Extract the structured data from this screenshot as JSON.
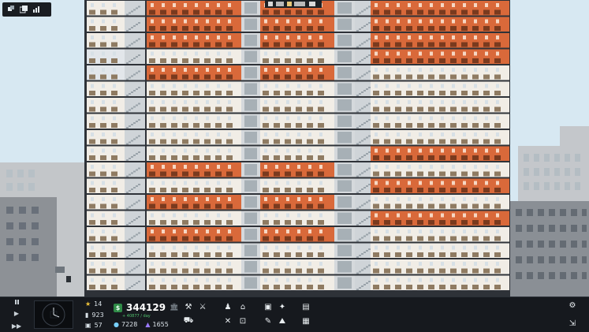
{
  "scene": {
    "floors": 18,
    "columns": [
      "left-offices",
      "left-stairs",
      "center-offices",
      "center-elevator",
      "right-offices"
    ],
    "colors": {
      "sky": "#d7e8f2",
      "wall": "#f3f0eb",
      "orange_office": "#d96a3a",
      "elevator": "#6f7b82",
      "hud_bg": "#16191e"
    },
    "top_banner_icons": [
      "people-icon",
      "coffee-icon"
    ]
  },
  "toolbar_top_left": {
    "icons": [
      "overview-icon",
      "stack-icon",
      "graph-icon"
    ]
  },
  "hud": {
    "controls": [
      "pause-icon",
      "play-icon",
      "fast-forward-icon"
    ],
    "stats": {
      "rating": "14",
      "population": "923",
      "workers": "57"
    },
    "money": "344129",
    "income": "+ 40877 / day",
    "resources": {
      "credits": "7228",
      "research": "1655"
    },
    "tools_row1": [
      "hammer-icon",
      "cross-hammer-icon",
      "person-desk-icon",
      "house-icon",
      "package-icon",
      "handshake-icon",
      "book-icon"
    ],
    "tools_row2": [
      "vehicle-icon",
      "utensils-icon",
      "cart-icon",
      "paintbrush-icon",
      "landscape-icon",
      "picture-icon"
    ],
    "right_icons": [
      "gear-icon",
      "exit-icon"
    ]
  }
}
